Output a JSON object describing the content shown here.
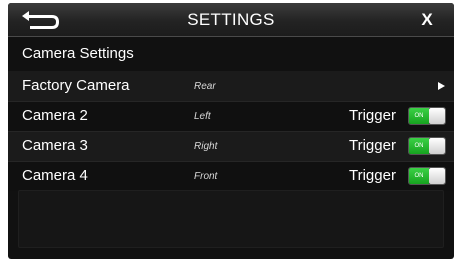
{
  "header": {
    "back_icon": "back-arrow-icon",
    "title": "SETTINGS",
    "close_label": "X"
  },
  "section": {
    "title": "Camera Settings"
  },
  "cameras": [
    {
      "name": "Factory Camera",
      "position": "Rear",
      "has_arrow": true
    },
    {
      "name": "Camera 2",
      "position": "Left",
      "trigger_label": "Trigger",
      "toggle_state": "ON"
    },
    {
      "name": "Camera 3",
      "position": "Right",
      "trigger_label": "Trigger",
      "toggle_state": "ON"
    },
    {
      "name": "Camera 4",
      "position": "Front",
      "trigger_label": "Trigger",
      "toggle_state": "ON"
    }
  ],
  "colors": {
    "background": "#111111",
    "header": "#2c2c2c",
    "toggle_on": "#22b82c",
    "text": "#ffffff"
  }
}
